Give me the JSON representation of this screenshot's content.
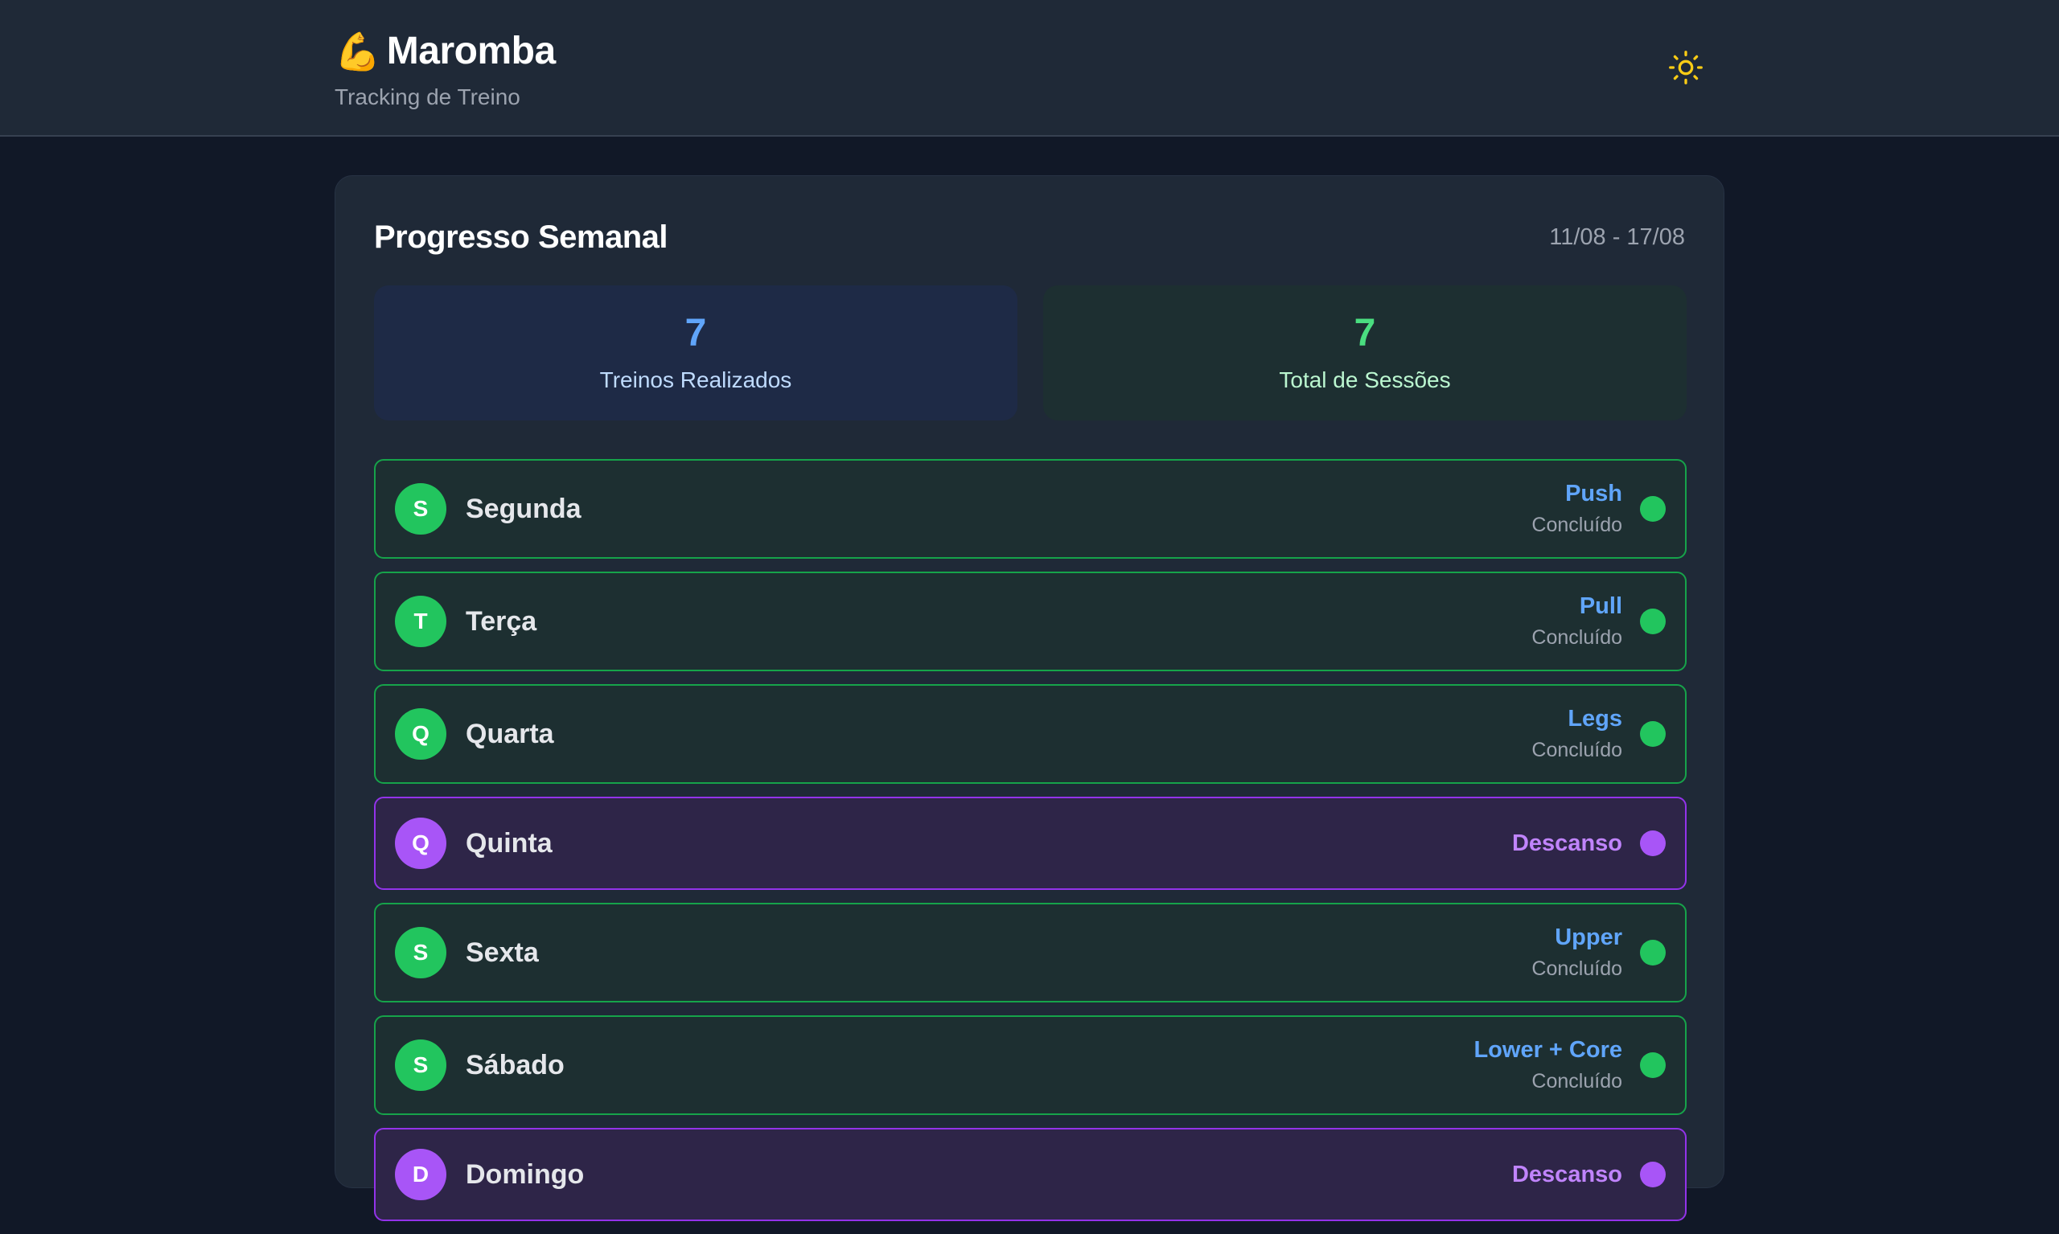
{
  "app": {
    "emoji": "💪",
    "title": "Maromba",
    "subtitle": "Tracking de Treino",
    "theme_icon": "sun-icon"
  },
  "progress": {
    "title": "Progresso Semanal",
    "range": "11/08 - 17/08",
    "stats": {
      "workouts_done": {
        "value": "7",
        "label": "Treinos Realizados"
      },
      "total_sessions": {
        "value": "7",
        "label": "Total de Sessões"
      }
    },
    "days": [
      {
        "initial": "S",
        "name": "Segunda",
        "workout": "Push",
        "status": "Concluído",
        "type": "done"
      },
      {
        "initial": "T",
        "name": "Terça",
        "workout": "Pull",
        "status": "Concluído",
        "type": "done"
      },
      {
        "initial": "Q",
        "name": "Quarta",
        "workout": "Legs",
        "status": "Concluído",
        "type": "done"
      },
      {
        "initial": "Q",
        "name": "Quinta",
        "workout": "Descanso",
        "status": "",
        "type": "rest"
      },
      {
        "initial": "S",
        "name": "Sexta",
        "workout": "Upper",
        "status": "Concluído",
        "type": "done"
      },
      {
        "initial": "S",
        "name": "Sábado",
        "workout": "Lower + Core",
        "status": "Concluído",
        "type": "done"
      },
      {
        "initial": "D",
        "name": "Domingo",
        "workout": "Descanso",
        "status": "",
        "type": "rest"
      }
    ]
  },
  "colors": {
    "background": "#111827",
    "surface": "#1f2937",
    "done_accent": "#22c55e",
    "rest_accent": "#a855f7",
    "workout_text": "#60a5fa",
    "sun_icon": "#facc15"
  }
}
